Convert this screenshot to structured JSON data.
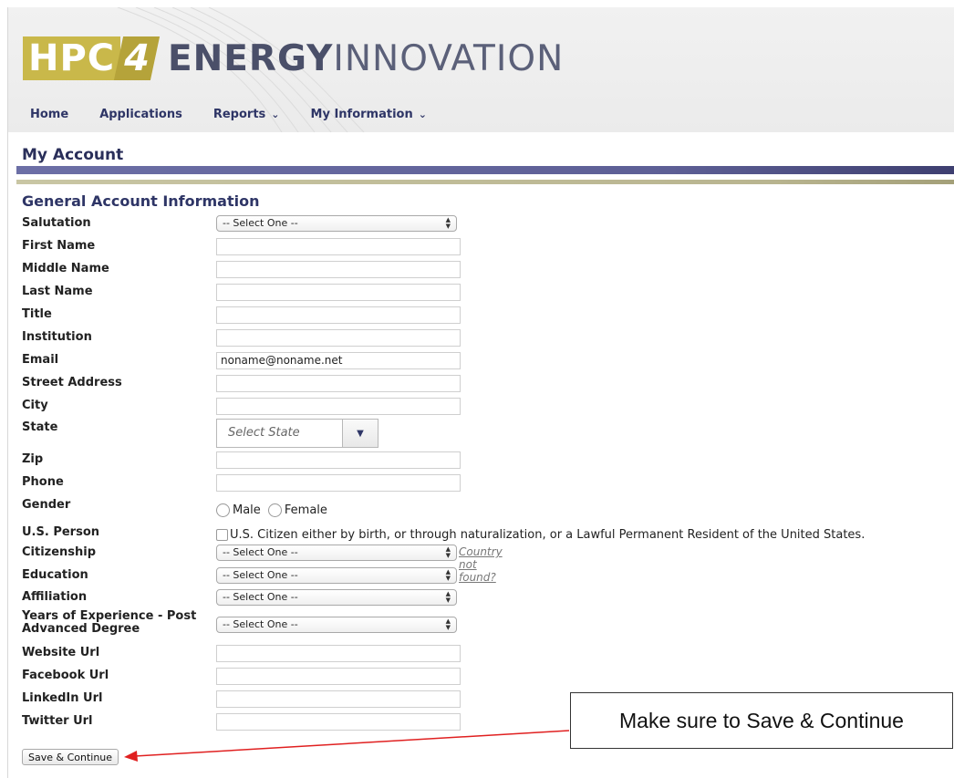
{
  "logo": {
    "hpc": "HPC",
    "num": "4",
    "energy": "ENERGY",
    "innovation": "INNOVATION"
  },
  "nav": {
    "items": [
      {
        "label": "Home",
        "has_dropdown": false
      },
      {
        "label": "Applications",
        "has_dropdown": false
      },
      {
        "label": "Reports",
        "has_dropdown": true
      },
      {
        "label": "My Information",
        "has_dropdown": true
      }
    ]
  },
  "page_title": "My Account",
  "section_title": "General Account Information",
  "form": {
    "salutation": {
      "label": "Salutation",
      "value": "-- Select One --"
    },
    "first_name": {
      "label": "First Name",
      "value": ""
    },
    "middle_name": {
      "label": "Middle Name",
      "value": ""
    },
    "last_name": {
      "label": "Last Name",
      "value": ""
    },
    "title": {
      "label": "Title",
      "value": ""
    },
    "institution": {
      "label": "Institution",
      "value": ""
    },
    "email": {
      "label": "Email",
      "value": "noname@noname.net"
    },
    "street_address": {
      "label": "Street Address",
      "value": ""
    },
    "city": {
      "label": "City",
      "value": ""
    },
    "state": {
      "label": "State",
      "placeholder": "Select State"
    },
    "zip": {
      "label": "Zip",
      "value": ""
    },
    "phone": {
      "label": "Phone",
      "value": ""
    },
    "gender": {
      "label": "Gender",
      "options": [
        "Male",
        "Female"
      ],
      "selected": null
    },
    "us_person": {
      "label": "U.S. Person",
      "checkbox_label": "U.S. Citizen either by birth, or through naturalization, or a Lawful Permanent Resident of the United States.",
      "checked": false
    },
    "citizenship": {
      "label": "Citizenship",
      "value": "-- Select One --",
      "link": "Country not found?"
    },
    "education": {
      "label": "Education",
      "value": "-- Select One --"
    },
    "affiliation": {
      "label": "Affiliation",
      "value": "-- Select One --"
    },
    "experience": {
      "label_line1": "Years of Experience - Post",
      "label_line2": "Advanced Degree",
      "value": "-- Select One --"
    },
    "website_url": {
      "label": "Website Url",
      "value": ""
    },
    "facebook_url": {
      "label": "Facebook Url",
      "value": ""
    },
    "linkedin_url": {
      "label": "LinkedIn Url",
      "value": ""
    },
    "twitter_url": {
      "label": "Twitter Url",
      "value": ""
    }
  },
  "save_button": "Save & Continue",
  "callout": "Make sure to Save & Continue",
  "colors": {
    "nav_text": "#2e3566",
    "title_text": "#2a2f5a",
    "logo_gold": "#c9b84a",
    "purple_bar": "#5d5f95",
    "gold_bar": "#b9b590",
    "arrow": "#e02020"
  }
}
